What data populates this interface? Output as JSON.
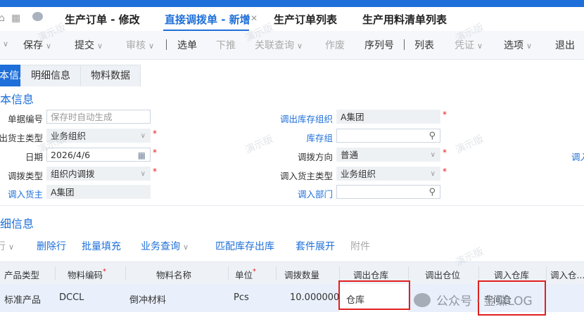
{
  "tabs": [
    {
      "label": "生产订单 - 修改"
    },
    {
      "label": "直接调拨单 - 新增"
    },
    {
      "label": "生产订单列表"
    },
    {
      "label": "生产用料清单列表"
    }
  ],
  "toolbar": {
    "save": "保存",
    "submit": "提交",
    "audit": "审核",
    "select": "选单",
    "push": "下推",
    "related": "关联查询",
    "void": "作废",
    "serial": "序列号",
    "list": "列表",
    "voucher": "凭证",
    "options": "选项",
    "exit": "退出"
  },
  "subtabs": [
    "基本信息",
    "明细信息",
    "物料数据"
  ],
  "basic": {
    "title": "基本信息",
    "labels": {
      "bill_no": "单据编号",
      "out_owner_type": "调出货主类型",
      "date": "日期",
      "transfer_type": "调拨类型",
      "in_owner": "调入货主",
      "out_org": "调出库存组织",
      "stock_group": "库存组",
      "direction": "调拨方向",
      "in_owner_type": "调入货主类型",
      "in_dept": "调入部门",
      "right_cut": "调入"
    },
    "values": {
      "bill_no_placeholder": "保存时自动生成",
      "out_owner_type": "业务组织",
      "date": "2026/4/6",
      "transfer_type": "组织内调拨",
      "in_owner": "A集团",
      "out_org": "A集团",
      "direction": "普通",
      "in_owner_type": "业务组织"
    }
  },
  "detail": {
    "title": "明细信息",
    "toolbar": {
      "row": "行",
      "delete_row": "删除行",
      "batch_fill": "批量填充",
      "business_query": "业务查询",
      "match_stock": "匹配库存出库",
      "kit_expand": "套件展开",
      "attachment": "附件"
    },
    "columns": [
      "产品类型",
      "物料编码",
      "物料名称",
      "单位",
      "调拨数量",
      "调出仓库",
      "调出仓位",
      "调入仓库",
      "调入仓..."
    ],
    "rows": [
      {
        "product_type": "标准产品",
        "material_code": "DCCL",
        "material_name": "倒冲材料",
        "unit": "Pcs",
        "qty": "10.000000",
        "out_wh": "仓库",
        "out_loc": "",
        "in_wh": "车间仓",
        "in_loc": ""
      }
    ]
  },
  "watermarks": {
    "demo": "演示版",
    "wechat": "公众号 · 金蝶LOG"
  },
  "colors": {
    "accent": "#1e6fd9",
    "required": "#e02020",
    "highlight_box": "#e02020"
  }
}
